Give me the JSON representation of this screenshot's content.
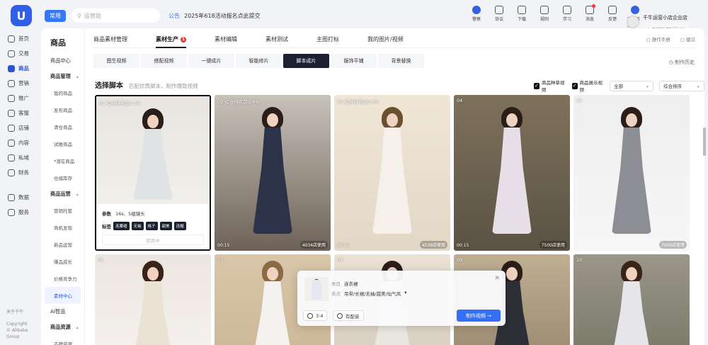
{
  "header": {
    "logo": "U",
    "tag": "常用",
    "search_placeholder": "运营助",
    "notice_label": "公告",
    "notice_text": "2025年618活动报名点此提交",
    "tools": [
      {
        "label": "警察",
        "icon": "badge-icon"
      },
      {
        "label": "协议",
        "icon": "document-icon"
      },
      {
        "label": "下载",
        "icon": "download-icon"
      },
      {
        "label": "规则",
        "icon": "book-icon"
      },
      {
        "label": "学习",
        "icon": "learn-icon"
      },
      {
        "label": "消息",
        "icon": "bell-icon"
      },
      {
        "label": "反馈",
        "icon": "feedback-icon"
      },
      {
        "label": "官方客服",
        "icon": "service-icon"
      }
    ],
    "account_name": "千牛运营小店企业店",
    "account_sub": "dx店铺测试账号001"
  },
  "left_nav": [
    {
      "label": "首页",
      "icon": "home-icon"
    },
    {
      "label": "交易",
      "icon": "trade-icon"
    },
    {
      "label": "商品",
      "icon": "goods-icon",
      "active": true
    },
    {
      "label": "营销",
      "icon": "marketing-icon"
    },
    {
      "label": "推广",
      "icon": "promote-icon"
    },
    {
      "label": "客服",
      "icon": "support-icon"
    },
    {
      "label": "店铺",
      "icon": "store-icon"
    },
    {
      "label": "内容",
      "icon": "content-icon"
    },
    {
      "label": "私域",
      "icon": "private-icon"
    },
    {
      "label": "财务",
      "icon": "finance-icon"
    },
    {
      "label": "数据",
      "icon": "data-icon"
    },
    {
      "label": "服务",
      "icon": "service-icon"
    }
  ],
  "left_footer": {
    "about": "关于千牛",
    "copyright": "Copyright",
    "company": "© Alibaba Group"
  },
  "sub_nav": {
    "title": "商品",
    "items": [
      {
        "label": "商品中心",
        "type": "item"
      },
      {
        "label": "商品管理",
        "type": "group"
      },
      {
        "label": "我的商品",
        "type": "sub"
      },
      {
        "label": "发布商品",
        "type": "sub"
      },
      {
        "label": "清仓商品",
        "type": "sub"
      },
      {
        "label": "试推商品",
        "type": "sub"
      },
      {
        "label": "*潜在商品",
        "type": "sub"
      },
      {
        "label": "仓储库存",
        "type": "sub"
      },
      {
        "label": "商品运营",
        "type": "group"
      },
      {
        "label": "营销托管",
        "type": "sub"
      },
      {
        "label": "商机发现",
        "type": "sub"
      },
      {
        "label": "新品运营",
        "type": "sub"
      },
      {
        "label": "赚品成长",
        "type": "sub"
      },
      {
        "label": "价格竞争力",
        "type": "sub"
      },
      {
        "label": "素材中心",
        "type": "active"
      },
      {
        "label": "AI智品",
        "type": "item"
      },
      {
        "label": "商品资源",
        "type": "group"
      },
      {
        "label": "品牌资源",
        "type": "sub"
      }
    ]
  },
  "top_tabs": [
    {
      "label": "商品素材管理"
    },
    {
      "label": "素材生产",
      "active": true,
      "badge": "1"
    },
    {
      "label": "素材编辑"
    },
    {
      "label": "素材测试"
    },
    {
      "label": "主图打标"
    },
    {
      "label": "我的图片/视频"
    }
  ],
  "top_right": {
    "guide": "操作手册",
    "feedback": "建议"
  },
  "sub_tabs": [
    {
      "label": "图生视频"
    },
    {
      "label": "搭配视频"
    },
    {
      "label": "一键成片"
    },
    {
      "label": "智能修片"
    },
    {
      "label": "脚本成片",
      "active": true
    },
    {
      "label": "服饰平铺"
    },
    {
      "label": "背景替换"
    }
  ],
  "history": "制作历史",
  "section": {
    "title": "选择脚本",
    "subtitle": "匹配优质脚本，制作爆款视频"
  },
  "filters": {
    "check1": "商品种草视频",
    "check2": "商品展示视频",
    "select1": "全部",
    "select2": "综合排序"
  },
  "cards": [
    {
      "idx": "01 综合排名前0.3%",
      "bl": "",
      "br": "",
      "selected": true,
      "bg": "#f1efea",
      "wall": "#e9e6e1",
      "dress": "#dfe3e6",
      "hair": "#2b1e18"
    },
    {
      "idx": "02 综合排名前0.4%",
      "bl": "00:15",
      "br": "4034店使用",
      "bg": "#6e6258",
      "wall": "#c8c2b9",
      "dress": "#2c3348",
      "hair": "#2b1e18"
    },
    {
      "idx": "03 综合排名前0.4%",
      "bl": "00:15",
      "br": "4539店使用",
      "bg": "#e3d8c6",
      "wall": "#f0e6d6",
      "dress": "#f5f0ea",
      "hair": "#6b5030"
    },
    {
      "idx": "04",
      "bl": "00:15",
      "br": "7500店使用",
      "bg": "#5a5243",
      "wall": "#7f725c",
      "dress": "#e7dfe8",
      "hair": "#2b1e18"
    },
    {
      "idx": "05",
      "bl": "",
      "br": "7000店使用",
      "bg": "#f6f6f6",
      "wall": "#efefef",
      "dress": "#8d8e95",
      "hair": "#2b1e18"
    },
    {
      "idx": "06",
      "bl": "",
      "br": "",
      "bg": "#f5f1ee",
      "wall": "#ece6e0",
      "dress": "#eae2d2",
      "hair": "#3a2418"
    },
    {
      "idx": "07",
      "bl": "",
      "br": "",
      "bg": "#cdb898",
      "wall": "#d9c6a8",
      "dress": "#f4f2ee",
      "hair": "#8b6a44"
    },
    {
      "idx": "08",
      "bl": "",
      "br": "",
      "bg": "#d9d0c2",
      "wall": "#ebe2d5",
      "dress": "#eae6e0",
      "hair": "#2b1e18"
    },
    {
      "idx": "09",
      "bl": "",
      "br": "",
      "bg": "#9c8c74",
      "wall": "#bfae92",
      "dress": "#2d2f36",
      "hair": "#2b1e18"
    },
    {
      "idx": "10",
      "bl": "",
      "br": "",
      "bg": "#7a7a6a",
      "wall": "#9a968a",
      "dress": "#e6e6ea",
      "hair": "#3a2418"
    }
  ],
  "selected_info": {
    "param_label": "参数",
    "param_value": "16s、5组镜头",
    "tag_label": "标签",
    "tags": [
      "连腰裙",
      "无袖",
      "格子",
      "甜美",
      "连帽"
    ],
    "use_label": "使用中"
  },
  "popup": {
    "type_key": "类目",
    "type_value": "连衣裙",
    "sell_key": "卖点",
    "sell_value": "吊带/长裙/无袖/甜美/仙气风",
    "ratio": "3:4",
    "voice": "有配音",
    "make": "制作视频 →"
  },
  "colors": {
    "accent": "#3370f7",
    "dark": "#1c2030"
  }
}
